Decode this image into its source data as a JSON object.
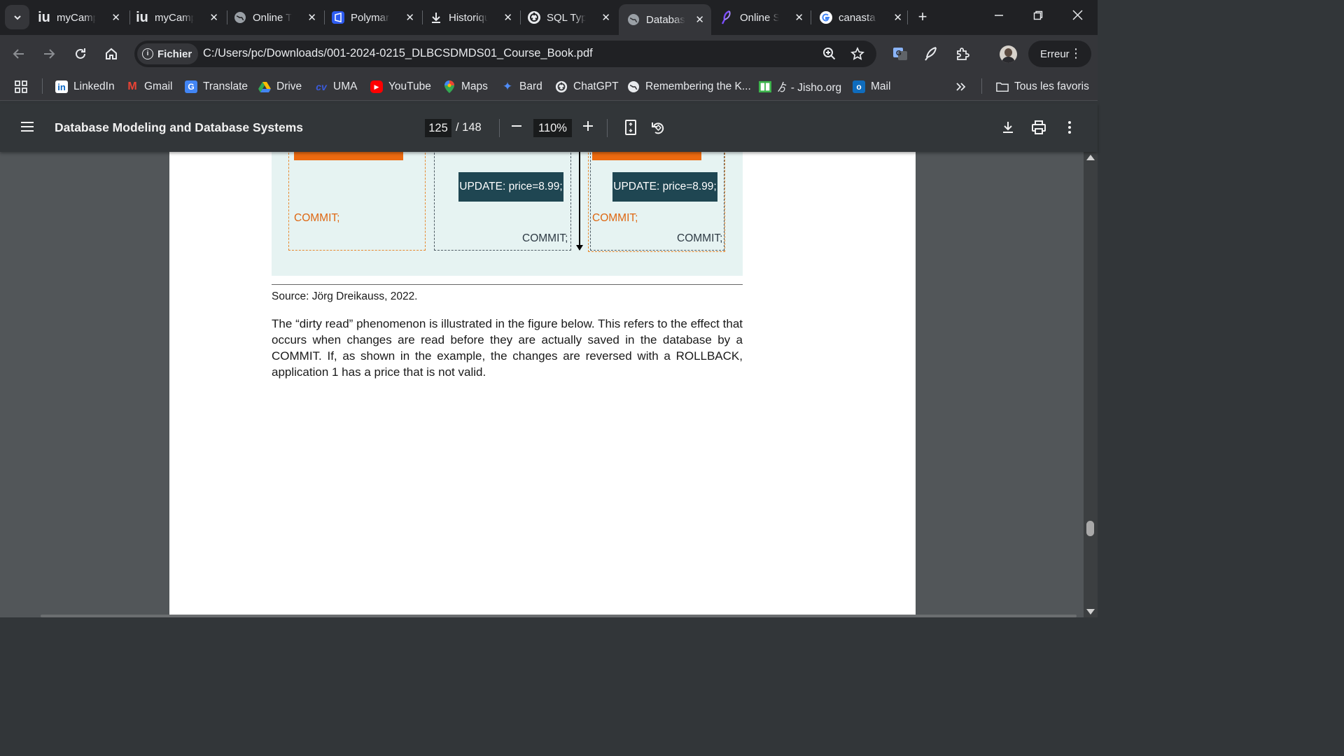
{
  "tabs": [
    {
      "title": "myCampus",
      "icon": "iu-logo-icon",
      "glyph": "iu"
    },
    {
      "title": "myCampus",
      "icon": "iu-logo-icon",
      "glyph": "iu"
    },
    {
      "title": "Online Tools",
      "icon": "globe-icon",
      "glyph": ""
    },
    {
      "title": "Polymarket",
      "icon": "polymarket-icon",
      "glyph": ""
    },
    {
      "title": "Historique",
      "icon": "download-icon",
      "glyph": ""
    },
    {
      "title": "SQL Types",
      "icon": "chatgpt-icon",
      "glyph": ""
    },
    {
      "title": "Database",
      "icon": "globe-icon",
      "glyph": "",
      "active": true
    },
    {
      "title": "Online SQL",
      "icon": "feather-icon",
      "glyph": ""
    },
    {
      "title": "canasta",
      "icon": "google-icon",
      "glyph": "G"
    }
  ],
  "toolbar": {
    "chip_label": "Fichier",
    "url": "C:/Users/pc/Downloads/001-2024-0215_DLBCSDMDS01_Course_Book.pdf",
    "error_label": "Erreur"
  },
  "bookmarks": [
    {
      "label": "LinkedIn",
      "icon": "linkedin-icon",
      "glyph": "in",
      "color": "#0a66c2"
    },
    {
      "label": "Gmail",
      "icon": "gmail-icon",
      "glyph": "M",
      "color": "#ea4335"
    },
    {
      "label": "Translate",
      "icon": "translate-icon",
      "glyph": "G",
      "color": "#4285f4"
    },
    {
      "label": "Drive",
      "icon": "drive-icon",
      "glyph": "▲",
      "color": "#34a853"
    },
    {
      "label": "UMA",
      "icon": "uma-icon",
      "glyph": "cv",
      "color": "#3b5bdb"
    },
    {
      "label": "YouTube",
      "icon": "youtube-icon",
      "glyph": "▶",
      "color": "#ff0000"
    },
    {
      "label": "Maps",
      "icon": "maps-icon",
      "glyph": "●",
      "color": "#34a853"
    },
    {
      "label": "Bard",
      "icon": "bard-icon",
      "glyph": "✦",
      "color": "#4f8cf7"
    },
    {
      "label": "ChatGPT",
      "icon": "chatgpt-icon",
      "glyph": "",
      "color": "#e8eaed"
    },
    {
      "label": "Remembering the K...",
      "icon": "globe-icon",
      "glyph": "",
      "color": "#e8eaed"
    },
    {
      "label": "ゟ - Jisho.org",
      "icon": "jisho-icon",
      "glyph": "",
      "color": "#3cb44b"
    },
    {
      "label": "Mail",
      "icon": "outlook-icon",
      "glyph": "o",
      "color": "#0f6cbd"
    }
  ],
  "all_bookmarks_label": "Tous les favoris",
  "pdf": {
    "title": "Database Modeling and Database Systems",
    "page_current": "125",
    "page_total": "/ 148",
    "zoom": "110%"
  },
  "diagram": {
    "update_1": "UPDATE: price=8.99;",
    "update_2": "UPDATE: price=8.99;",
    "commit_1": "COMMIT;",
    "commit_2": "COMMIT;",
    "commit_3": "COMMIT;",
    "commit_4": "COMMIT;"
  },
  "source": "Source: Jörg Dreikauss, 2022.",
  "body": "The “dirty read” phenomenon is illustrated in the figure below. This refers to the effect that occurs when changes are read before they are actually saved in the database by a COMMIT. If, as shown in the example, the changes are reversed with a ROLLBACK, application 1 has a price that is not valid.",
  "colors": {
    "accent_orange": "#ec6a10",
    "update_box": "#1f4652",
    "diagram_bg": "#e6f3f2"
  }
}
